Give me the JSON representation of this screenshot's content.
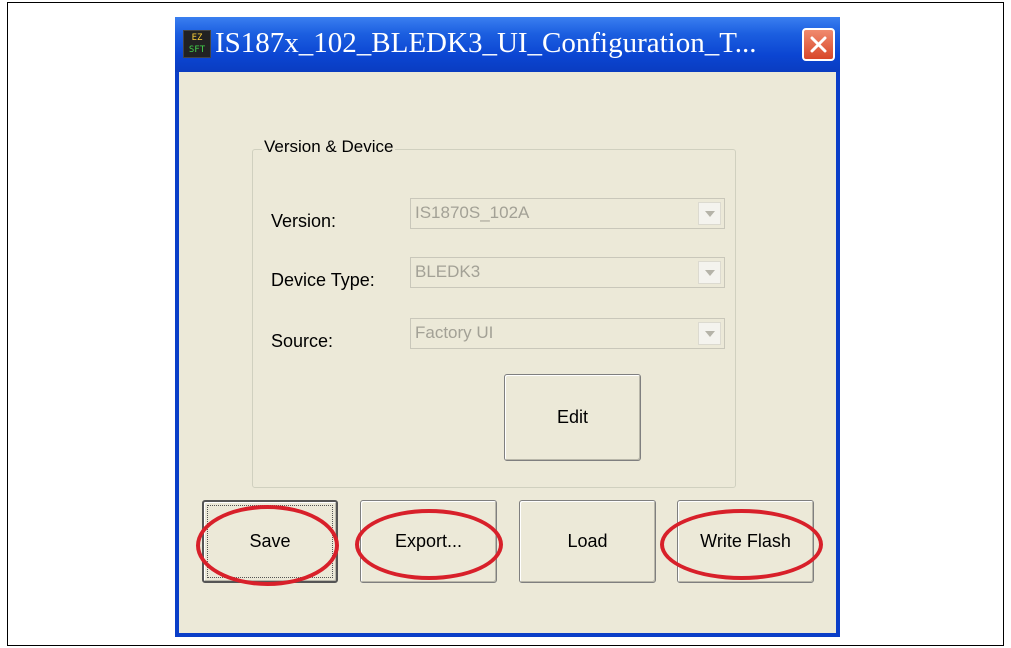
{
  "window": {
    "title": "IS187x_102_BLEDK3_UI_Configuration_T...",
    "app_icon_name": "ez-sft-app-icon",
    "app_icon_lines": [
      "EZ",
      "SFT"
    ],
    "close_icon": "close-icon"
  },
  "group": {
    "title": "Version & Device",
    "version_label": "Version:",
    "version_value": "IS1870S_102A",
    "device_type_label": "Device Type:",
    "device_type_value": "BLEDK3",
    "source_label": "Source:",
    "source_value": "Factory UI",
    "edit_label": "Edit"
  },
  "buttons": {
    "save": "Save",
    "export": "Export...",
    "load": "Load",
    "write_flash": "Write Flash"
  },
  "colors": {
    "titlebar": "#0b45d2",
    "client_bg": "#ece9d8",
    "annotation_circle": "#d8202a",
    "close_button": "#d8472a"
  }
}
